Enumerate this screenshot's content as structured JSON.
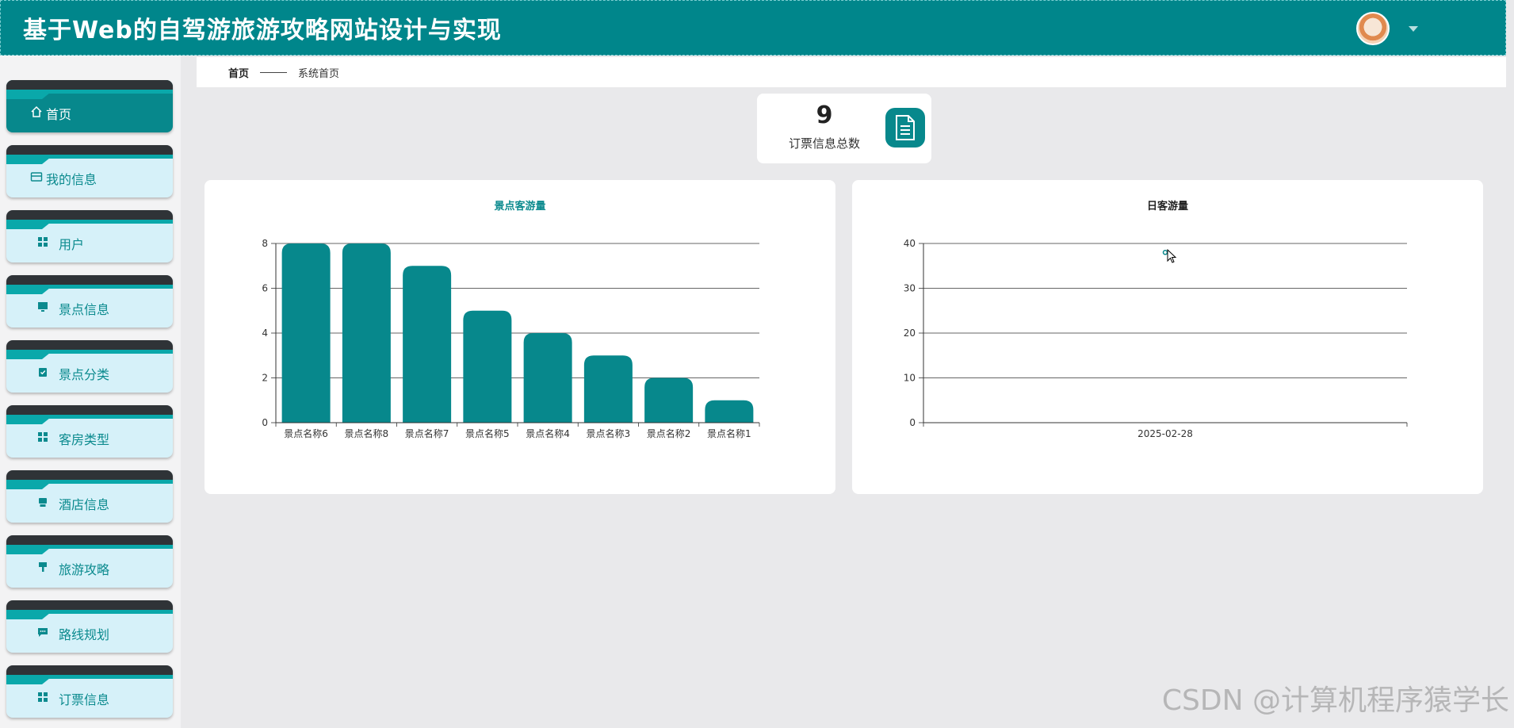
{
  "header": {
    "site_title": "基于Web的自驾游旅游攻略网站设计与实现"
  },
  "sidebar": {
    "items": [
      {
        "label": "首页",
        "icon": "home-icon",
        "active": true
      },
      {
        "label": "我的信息",
        "icon": "card-icon",
        "active": false
      },
      {
        "label": "用户",
        "icon": "grid-icon",
        "active": false
      },
      {
        "label": "景点信息",
        "icon": "monitor-icon",
        "active": false
      },
      {
        "label": "景点分类",
        "icon": "clipboard-check-icon",
        "active": false
      },
      {
        "label": "客房类型",
        "icon": "grid-icon",
        "active": false
      },
      {
        "label": "酒店信息",
        "icon": "printer-icon",
        "active": false
      },
      {
        "label": "旅游攻略",
        "icon": "brush-icon",
        "active": false
      },
      {
        "label": "路线规划",
        "icon": "message-icon",
        "active": false
      },
      {
        "label": "订票信息",
        "icon": "grid-icon",
        "active": false
      }
    ]
  },
  "breadcrumb": {
    "home": "首页",
    "current": "系统首页"
  },
  "stat": {
    "value": "9",
    "label": "订票信息总数",
    "icon": "document-icon"
  },
  "colors": {
    "accent": "#07888c",
    "header": "#00868b",
    "menu_bg": "#d6f1f9"
  },
  "watermark": "CSDN @计算机程序猿学长",
  "chart_data": [
    {
      "type": "bar",
      "title": "景点客游量",
      "categories": [
        "景点名称6",
        "景点名称8",
        "景点名称7",
        "景点名称5",
        "景点名称4",
        "景点名称3",
        "景点名称2",
        "景点名称1"
      ],
      "values": [
        8,
        8,
        7,
        5,
        4,
        3,
        2,
        1
      ],
      "ylim": [
        0,
        8
      ],
      "yticks": [
        0,
        2,
        4,
        6,
        8
      ],
      "grid": true,
      "color": "#07888c"
    },
    {
      "type": "line",
      "title": "日客游量",
      "categories": [
        "2025-02-28"
      ],
      "values": [
        38
      ],
      "ylim": [
        0,
        40
      ],
      "yticks": [
        0,
        10,
        20,
        30,
        40
      ],
      "grid": true,
      "color": "#07888c"
    }
  ]
}
